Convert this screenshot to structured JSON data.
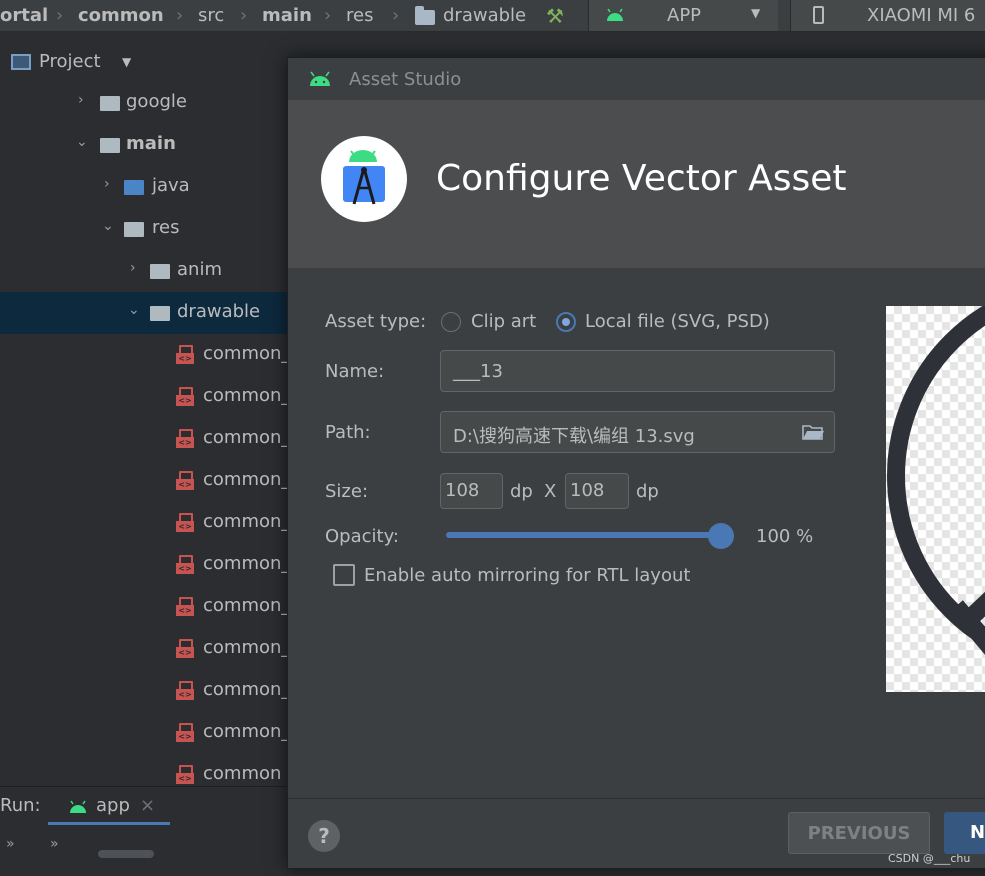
{
  "breadcrumb": {
    "items": [
      "ortal",
      "common",
      "src",
      "main",
      "res",
      "drawable"
    ],
    "run_config": "APP",
    "device": "XIAOMI MI 6"
  },
  "project_panel": {
    "title": "Project",
    "tree": [
      {
        "label": "google"
      },
      {
        "label": "main"
      },
      {
        "label": "java"
      },
      {
        "label": "res"
      },
      {
        "label": "anim"
      },
      {
        "label": "drawable"
      },
      {
        "label": "common_"
      },
      {
        "label": "common_"
      },
      {
        "label": "common_"
      },
      {
        "label": "common_"
      },
      {
        "label": "common_"
      },
      {
        "label": "common_"
      },
      {
        "label": "common_"
      },
      {
        "label": "common_"
      },
      {
        "label": "common_"
      },
      {
        "label": "common_"
      },
      {
        "label": "common"
      }
    ]
  },
  "run_bar": {
    "label": "Run:",
    "config": "app",
    "close": "×"
  },
  "dialog": {
    "title": "Asset Studio",
    "heading": "Configure Vector Asset",
    "asset_type_label": "Asset type:",
    "asset_type_options": [
      "Clip art",
      "Local file (SVG, PSD)"
    ],
    "asset_type_selected": "Local file (SVG, PSD)",
    "name_label": "Name:",
    "name_value": "___13",
    "path_label": "Path:",
    "path_value": "D:\\搜狗高速下载\\编组 13.svg",
    "size_label": "Size:",
    "width_value": "108",
    "height_value": "108",
    "unit": "dp",
    "size_separator": "X",
    "opacity_label": "Opacity:",
    "opacity_value": "100 %",
    "opacity_fraction": 1.0,
    "mirroring_label": "Enable auto mirroring for RTL layout",
    "mirroring_checked": false,
    "help": "?",
    "previous_button": "PREVIOUS",
    "next_button": "N"
  },
  "watermark": "CSDN @___chu",
  "colors": {
    "accent": "#4a78b5",
    "primary_button": "#365880",
    "android_green": "#3ddc84",
    "xml_icon": "#c75450"
  }
}
